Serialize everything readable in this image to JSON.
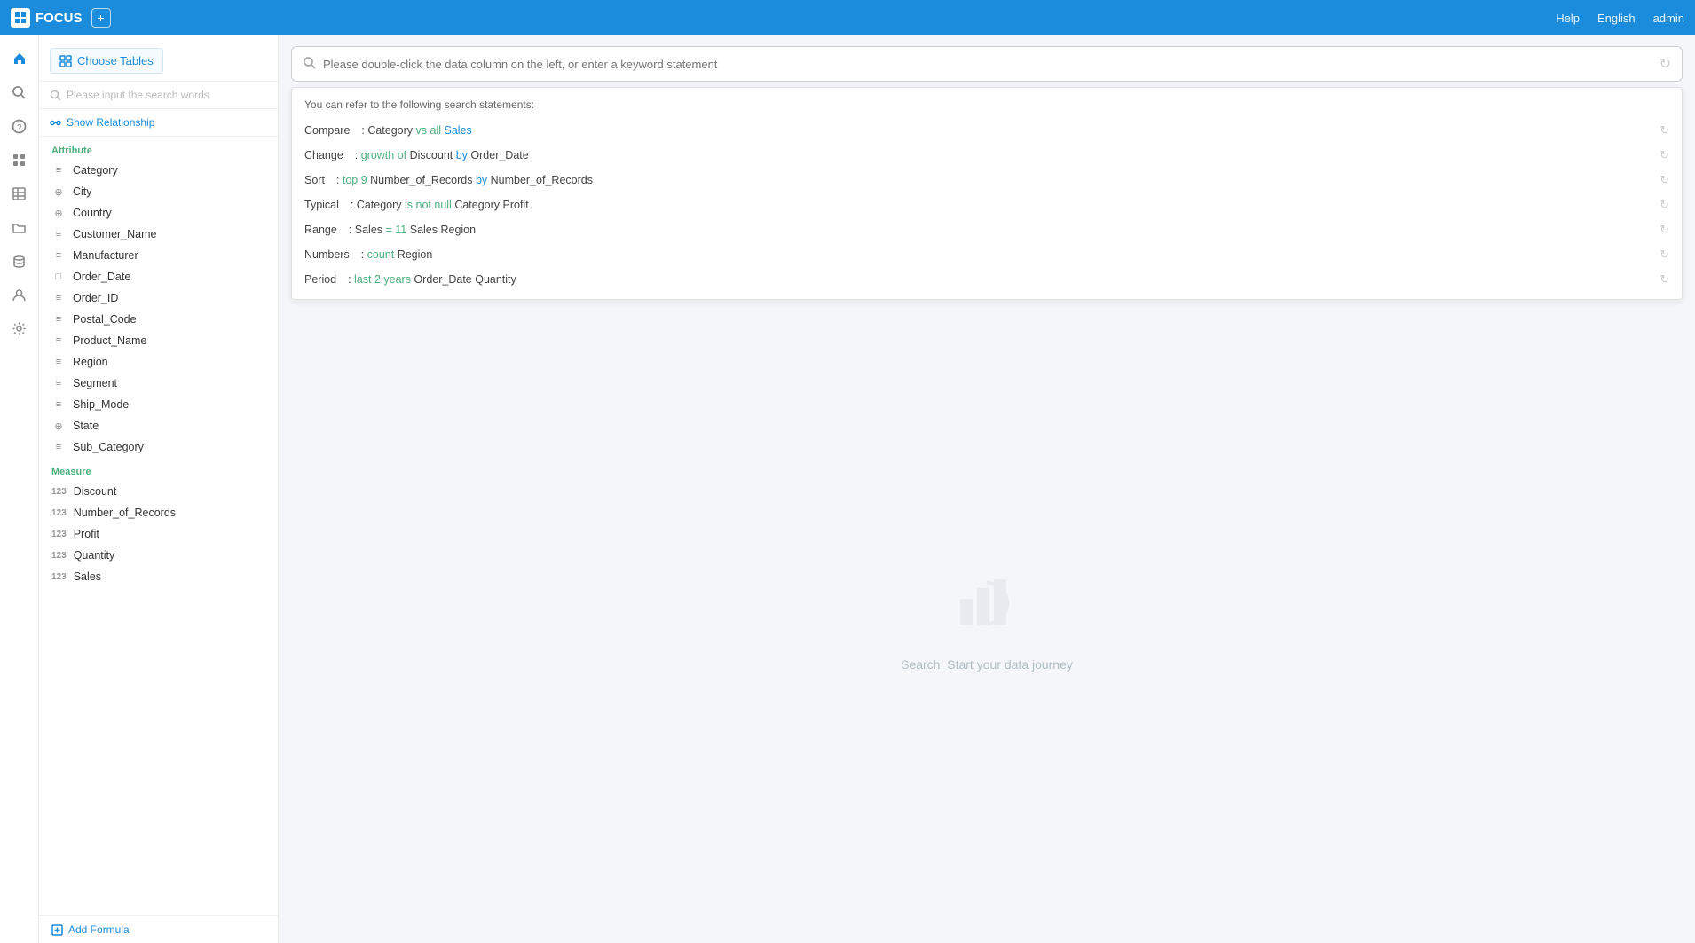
{
  "app": {
    "name": "FOCUS"
  },
  "topnav": {
    "logo": "FOCUS",
    "help": "Help",
    "language": "English",
    "user": "admin"
  },
  "sidebar": {
    "choose_tables_label": "Choose Tables",
    "search_placeholder": "Please input the search words",
    "show_relationship": "Show Relationship",
    "sections": [
      {
        "label": "Attribute",
        "items": [
          {
            "name": "Category",
            "type": "dim"
          },
          {
            "name": "City",
            "type": "geo"
          },
          {
            "name": "Country",
            "type": "geo"
          },
          {
            "name": "Customer_Name",
            "type": "dim"
          },
          {
            "name": "Manufacturer",
            "type": "dim"
          },
          {
            "name": "Order_Date",
            "type": "date"
          },
          {
            "name": "Order_ID",
            "type": "dim"
          },
          {
            "name": "Postal_Code",
            "type": "dim"
          },
          {
            "name": "Product_Name",
            "type": "dim"
          },
          {
            "name": "Region",
            "type": "dim"
          },
          {
            "name": "Segment",
            "type": "dim"
          },
          {
            "name": "Ship_Mode",
            "type": "dim"
          },
          {
            "name": "State",
            "type": "geo"
          },
          {
            "name": "Sub_Category",
            "type": "dim"
          }
        ]
      },
      {
        "label": "Measure",
        "items": [
          {
            "name": "Discount",
            "type": "num"
          },
          {
            "name": "Number_of_Records",
            "type": "num"
          },
          {
            "name": "Profit",
            "type": "num"
          },
          {
            "name": "Quantity",
            "type": "num"
          },
          {
            "name": "Sales",
            "type": "num"
          }
        ]
      }
    ],
    "add_formula_label": "Add Formula"
  },
  "search": {
    "placeholder": "Please double-click the data column on the left, or enter a keyword statement",
    "suggestions_header": "You can refer to the following search statements:",
    "suggestions": [
      {
        "type": "Compare",
        "text_before": ": Category ",
        "highlight1": "vs all",
        "highlight1_color": "green",
        "text_middle": " ",
        "highlight2": "Sales",
        "highlight2_color": "blue",
        "text_after": ""
      },
      {
        "type": "Change",
        "text_before": ": ",
        "highlight1": "growth of",
        "highlight1_color": "green",
        "text_middle": " Discount ",
        "highlight2": "by",
        "highlight2_color": "blue",
        "text_after": " Order_Date"
      },
      {
        "type": "Sort",
        "text_before": "   : ",
        "highlight1": "top 9",
        "highlight1_color": "green",
        "text_middle": " Number_of_Records ",
        "highlight2": "by",
        "highlight2_color": "blue",
        "text_after": " Number_of_Records"
      },
      {
        "type": "Typical",
        "text_before": "   : Category ",
        "highlight1": "is not null",
        "highlight1_color": "green",
        "text_middle": " Category Profit",
        "highlight2": "",
        "highlight2_color": "",
        "text_after": ""
      },
      {
        "type": "Range",
        "text_before": "   : Sales ",
        "highlight1": "= 11",
        "highlight1_color": "green",
        "text_middle": " Sales Region",
        "highlight2": "",
        "highlight2_color": "",
        "text_after": ""
      },
      {
        "type": "Numbers",
        "text_before": "   : ",
        "highlight1": "count",
        "highlight1_color": "green",
        "text_middle": " Region",
        "highlight2": "",
        "highlight2_color": "",
        "text_after": ""
      },
      {
        "type": "Period",
        "text_before": "   : ",
        "highlight1": "last 2 years",
        "highlight1_color": "green",
        "text_middle": " Order_Date Quantity",
        "highlight2": "",
        "highlight2_color": "",
        "text_after": ""
      }
    ]
  },
  "empty_state": {
    "text": "Search, Start your data journey"
  }
}
